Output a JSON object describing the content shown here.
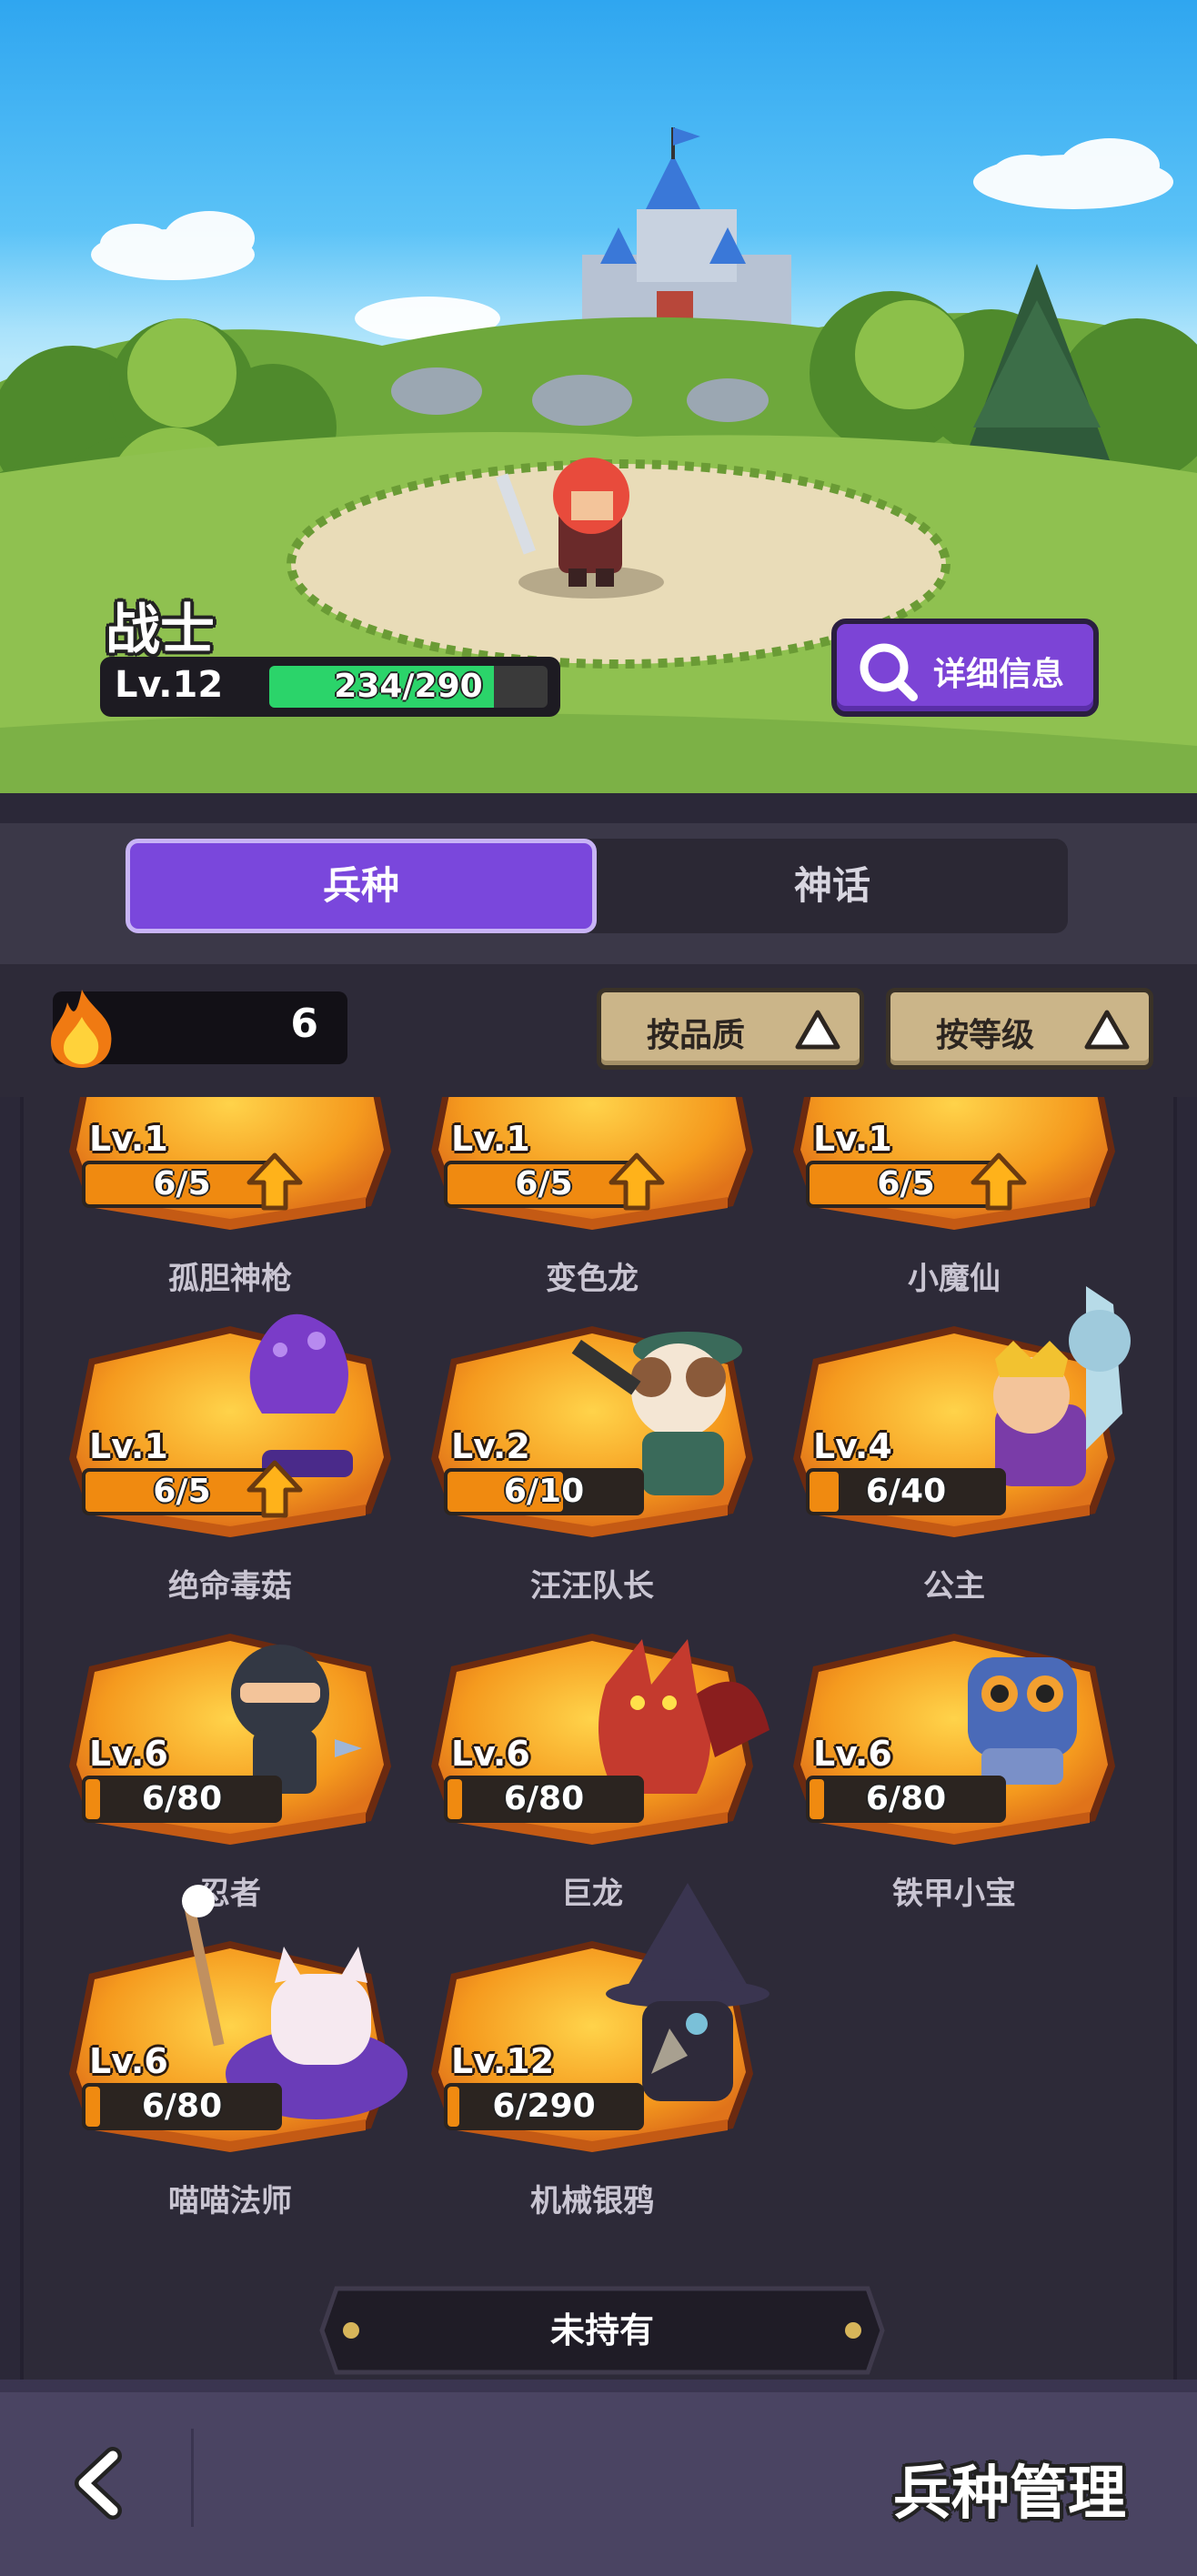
{
  "hero": {
    "name": "战士",
    "level": "Lv.12",
    "exp_text": "234/290",
    "exp_fraction": 0.807,
    "detail_button": "详细信息"
  },
  "tabs": [
    {
      "label": "兵种",
      "active": true
    },
    {
      "label": "神话",
      "active": false
    }
  ],
  "filter": {
    "fire_count": "6",
    "sort_quality": "按品质",
    "sort_level": "按等级"
  },
  "units": [
    {
      "name": "孤胆神枪",
      "level": "Lv.1",
      "progress": "6/5",
      "fill": 1.0,
      "upgrade": true,
      "icon": "gunner-icon"
    },
    {
      "name": "变色龙",
      "level": "Lv.1",
      "progress": "6/5",
      "fill": 1.0,
      "upgrade": true,
      "icon": "chameleon-icon"
    },
    {
      "name": "小魔仙",
      "level": "Lv.1",
      "progress": "6/5",
      "fill": 1.0,
      "upgrade": true,
      "icon": "little-fairy-icon"
    },
    {
      "name": "绝命毒菇",
      "level": "Lv.1",
      "progress": "6/5",
      "fill": 1.0,
      "upgrade": true,
      "icon": "poison-mushroom-icon"
    },
    {
      "name": "汪汪队长",
      "level": "Lv.2",
      "progress": "6/10",
      "fill": 0.6,
      "upgrade": false,
      "icon": "dog-captain-icon"
    },
    {
      "name": "公主",
      "level": "Lv.4",
      "progress": "6/40",
      "fill": 0.15,
      "upgrade": false,
      "icon": "princess-icon"
    },
    {
      "name": "忍者",
      "level": "Lv.6",
      "progress": "6/80",
      "fill": 0.075,
      "upgrade": false,
      "icon": "ninja-icon"
    },
    {
      "name": "巨龙",
      "level": "Lv.6",
      "progress": "6/80",
      "fill": 0.075,
      "upgrade": false,
      "icon": "dragon-icon"
    },
    {
      "name": "铁甲小宝",
      "level": "Lv.6",
      "progress": "6/80",
      "fill": 0.075,
      "upgrade": false,
      "icon": "robot-icon"
    },
    {
      "name": "喵喵法师",
      "level": "Lv.6",
      "progress": "6/80",
      "fill": 0.075,
      "upgrade": false,
      "icon": "cat-mage-icon"
    },
    {
      "name": "机械银鸦",
      "level": "Lv.12",
      "progress": "6/290",
      "fill": 0.021,
      "upgrade": false,
      "icon": "crow-mage-icon"
    }
  ],
  "not_owned_label": "未持有",
  "footer": {
    "title": "兵种管理"
  }
}
